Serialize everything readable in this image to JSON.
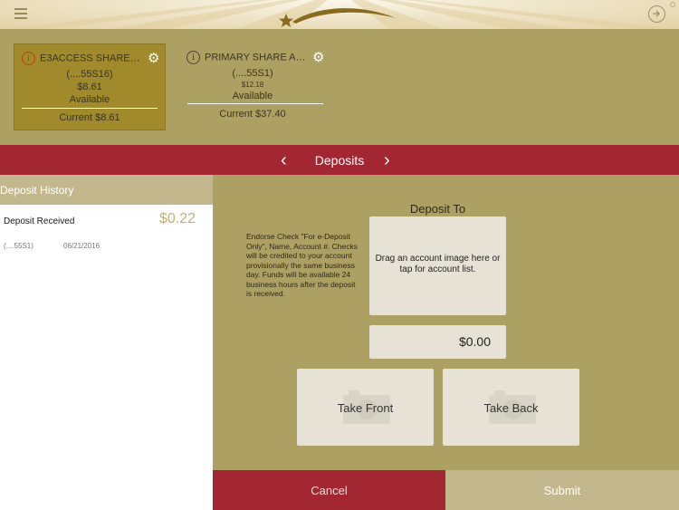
{
  "header": {
    "menu_icon": "hamburger-icon",
    "logo_icon": "star-swoosh-logo",
    "logout_icon": "logout-arrow-icon"
  },
  "accounts": [
    {
      "name": "E3ACCESS SHARE…",
      "number": "(....55S16)",
      "balance": "$8.61",
      "available_label": "Available",
      "current": "Current $8.61",
      "alert_icon": "info-icon",
      "settings_icon": "gear-icon",
      "selected": true
    },
    {
      "name": "PRIMARY SHARE A…",
      "number": "(....55S1)",
      "balance": "$12.18",
      "available_label": "Available",
      "current": "Current $37.40",
      "alert_icon": "info-icon",
      "settings_icon": "gear-icon",
      "selected": false
    }
  ],
  "nav": {
    "title": "Deposits",
    "prev": "‹",
    "next": "›"
  },
  "history": {
    "heading": "Deposit History",
    "items": [
      {
        "label": "Deposit Received",
        "amount": "$0.22",
        "account": "(....55S1)",
        "date": "06/21/2016"
      }
    ]
  },
  "deposit": {
    "instructions": "Endorse Check \"For e-Deposit Only\", Name, Account #. Checks will be credited to your account provisionally the same business day. Funds will be available 24 business hours after the deposit is received.",
    "deposit_to_label": "Deposit To",
    "target_hint": "Drag an account image here or tap for account list.",
    "amount": "$0.00",
    "take_front": "Take Front",
    "take_back": "Take Back",
    "camera_icon": "camera-icon"
  },
  "actions": {
    "cancel": "Cancel",
    "submit": "Submit"
  },
  "colors": {
    "brand_red": "#a32633",
    "brand_gold": "#ada063",
    "light_gold": "#c3b88d",
    "alert_red": "#c03a1c"
  }
}
